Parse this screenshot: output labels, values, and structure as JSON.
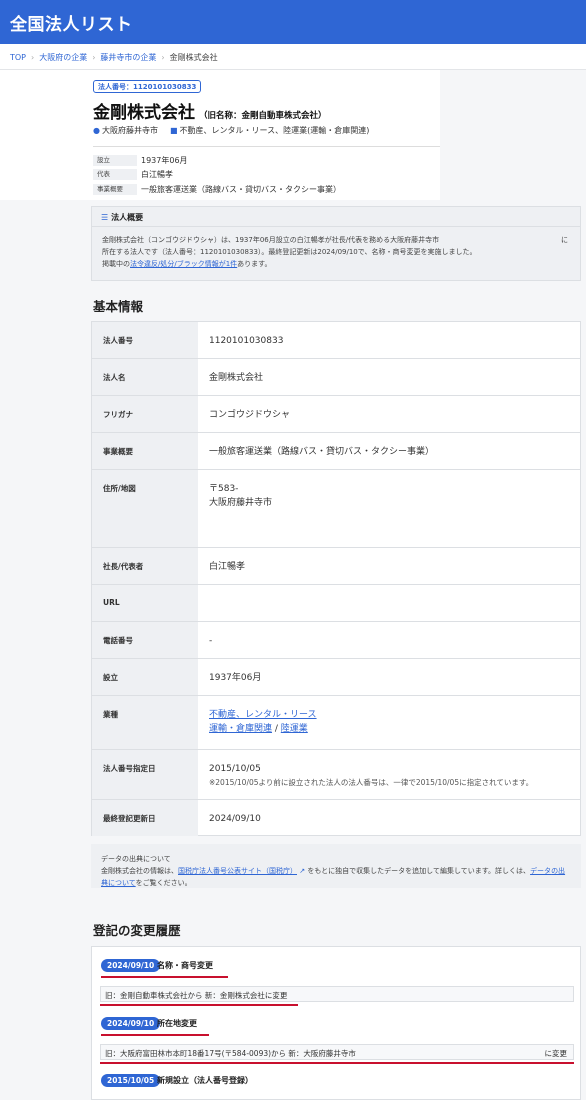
{
  "header": {
    "logo": "全国法人リスト",
    "color": "#2f66d4"
  },
  "breadcrumb": {
    "items": [
      "TOP",
      "大阪府の企業",
      "藤井寺市の企業",
      "金剛株式会社"
    ]
  },
  "company": {
    "badge": "法人番号：1120101030833",
    "name": "金剛株式会社",
    "former_name": "（旧名称：金剛自動車株式会社）",
    "location": "大阪府藤井寺市",
    "industry": "不動産、レンタル・リース、陸運業(運輸・倉庫関連)",
    "mini": [
      {
        "key": "設立",
        "value": "1937年06月"
      },
      {
        "key": "代表",
        "value": "白江暢孝"
      },
      {
        "key": "事業概要",
        "value": "一般旅客運送業（路線バス・貸切バス・タクシー事業）"
      }
    ]
  },
  "summary": {
    "title": "法人概要",
    "line1": "金剛株式会社（コンゴウジドウシャ）は、1937年06月設立の白江暢孝が社長/代表を務める大阪府藤井寺市",
    "tail": "に",
    "line2": "所在する法人です（法人番号：1120101030833）。最終登記更新は2024/09/10で、名称・商号変更を実施しました。",
    "line3_pre": "掲載中の",
    "line3_link": "法令違反/処分/ブラック情報が1件",
    "line3_post": "あります。"
  },
  "basic": {
    "heading": "基本情報",
    "rows": [
      {
        "key": "法人番号",
        "value": "1120101030833"
      },
      {
        "key": "法人名",
        "value": "金剛株式会社"
      },
      {
        "key": "フリガナ",
        "value": "コンゴウジドウシャ"
      },
      {
        "key": "事業概要",
        "value": "一般旅客運送業（路線バス・貸切バス・タクシー事業）"
      },
      {
        "key": "住所/地図",
        "value": "〒583-",
        "value2": "大阪府藤井寺市"
      },
      {
        "key": "社長/代表者",
        "value": "白江暢孝"
      },
      {
        "key": "URL",
        "value": ""
      },
      {
        "key": "電話番号",
        "value": "-"
      },
      {
        "key": "設立",
        "value": "1937年06月"
      },
      {
        "key": "業種",
        "link1": "不動産、レンタル・リース",
        "link2": "運輸・倉庫関連",
        "sep": " / ",
        "link3": "陸運業"
      },
      {
        "key": "法人番号指定日",
        "value": "2015/10/05",
        "note": "※2015/10/05より前に設立された法人の法人番号は、一律で2015/10/05に指定されています。"
      },
      {
        "key": "最終登記更新日",
        "value": "2024/09/10"
      }
    ]
  },
  "source": {
    "title": "データの出典について",
    "pre": "金剛株式会社の情報は、",
    "link1": "国税庁法人番号公表サイト（国税庁）",
    "mid": " をもとに独自で収集したデータを追加して編集しています。詳しくは、",
    "link2a": "データ",
    "link2b": "の出典について",
    "post": "をご覧ください。"
  },
  "history": {
    "heading": "登記の変更履歴",
    "items": [
      {
        "date": "2024/09/10",
        "label": "名称・商号変更",
        "detail": "旧：金剛自動車株式会社から 新：金剛株式会社に変更",
        "detail_right": ""
      },
      {
        "date": "2024/09/10",
        "label": "所在地変更",
        "detail": "旧：大阪府富田林市本町18番17号(〒584-0093)から 新：大阪府藤井寺市",
        "detail_right": "に変更"
      },
      {
        "date": "2015/10/05",
        "label": "新規設立（法人番号登録）",
        "detail": "",
        "detail_right": ""
      }
    ]
  },
  "colors": {
    "accent": "#2f66d4",
    "highlight": "#c8102e"
  }
}
